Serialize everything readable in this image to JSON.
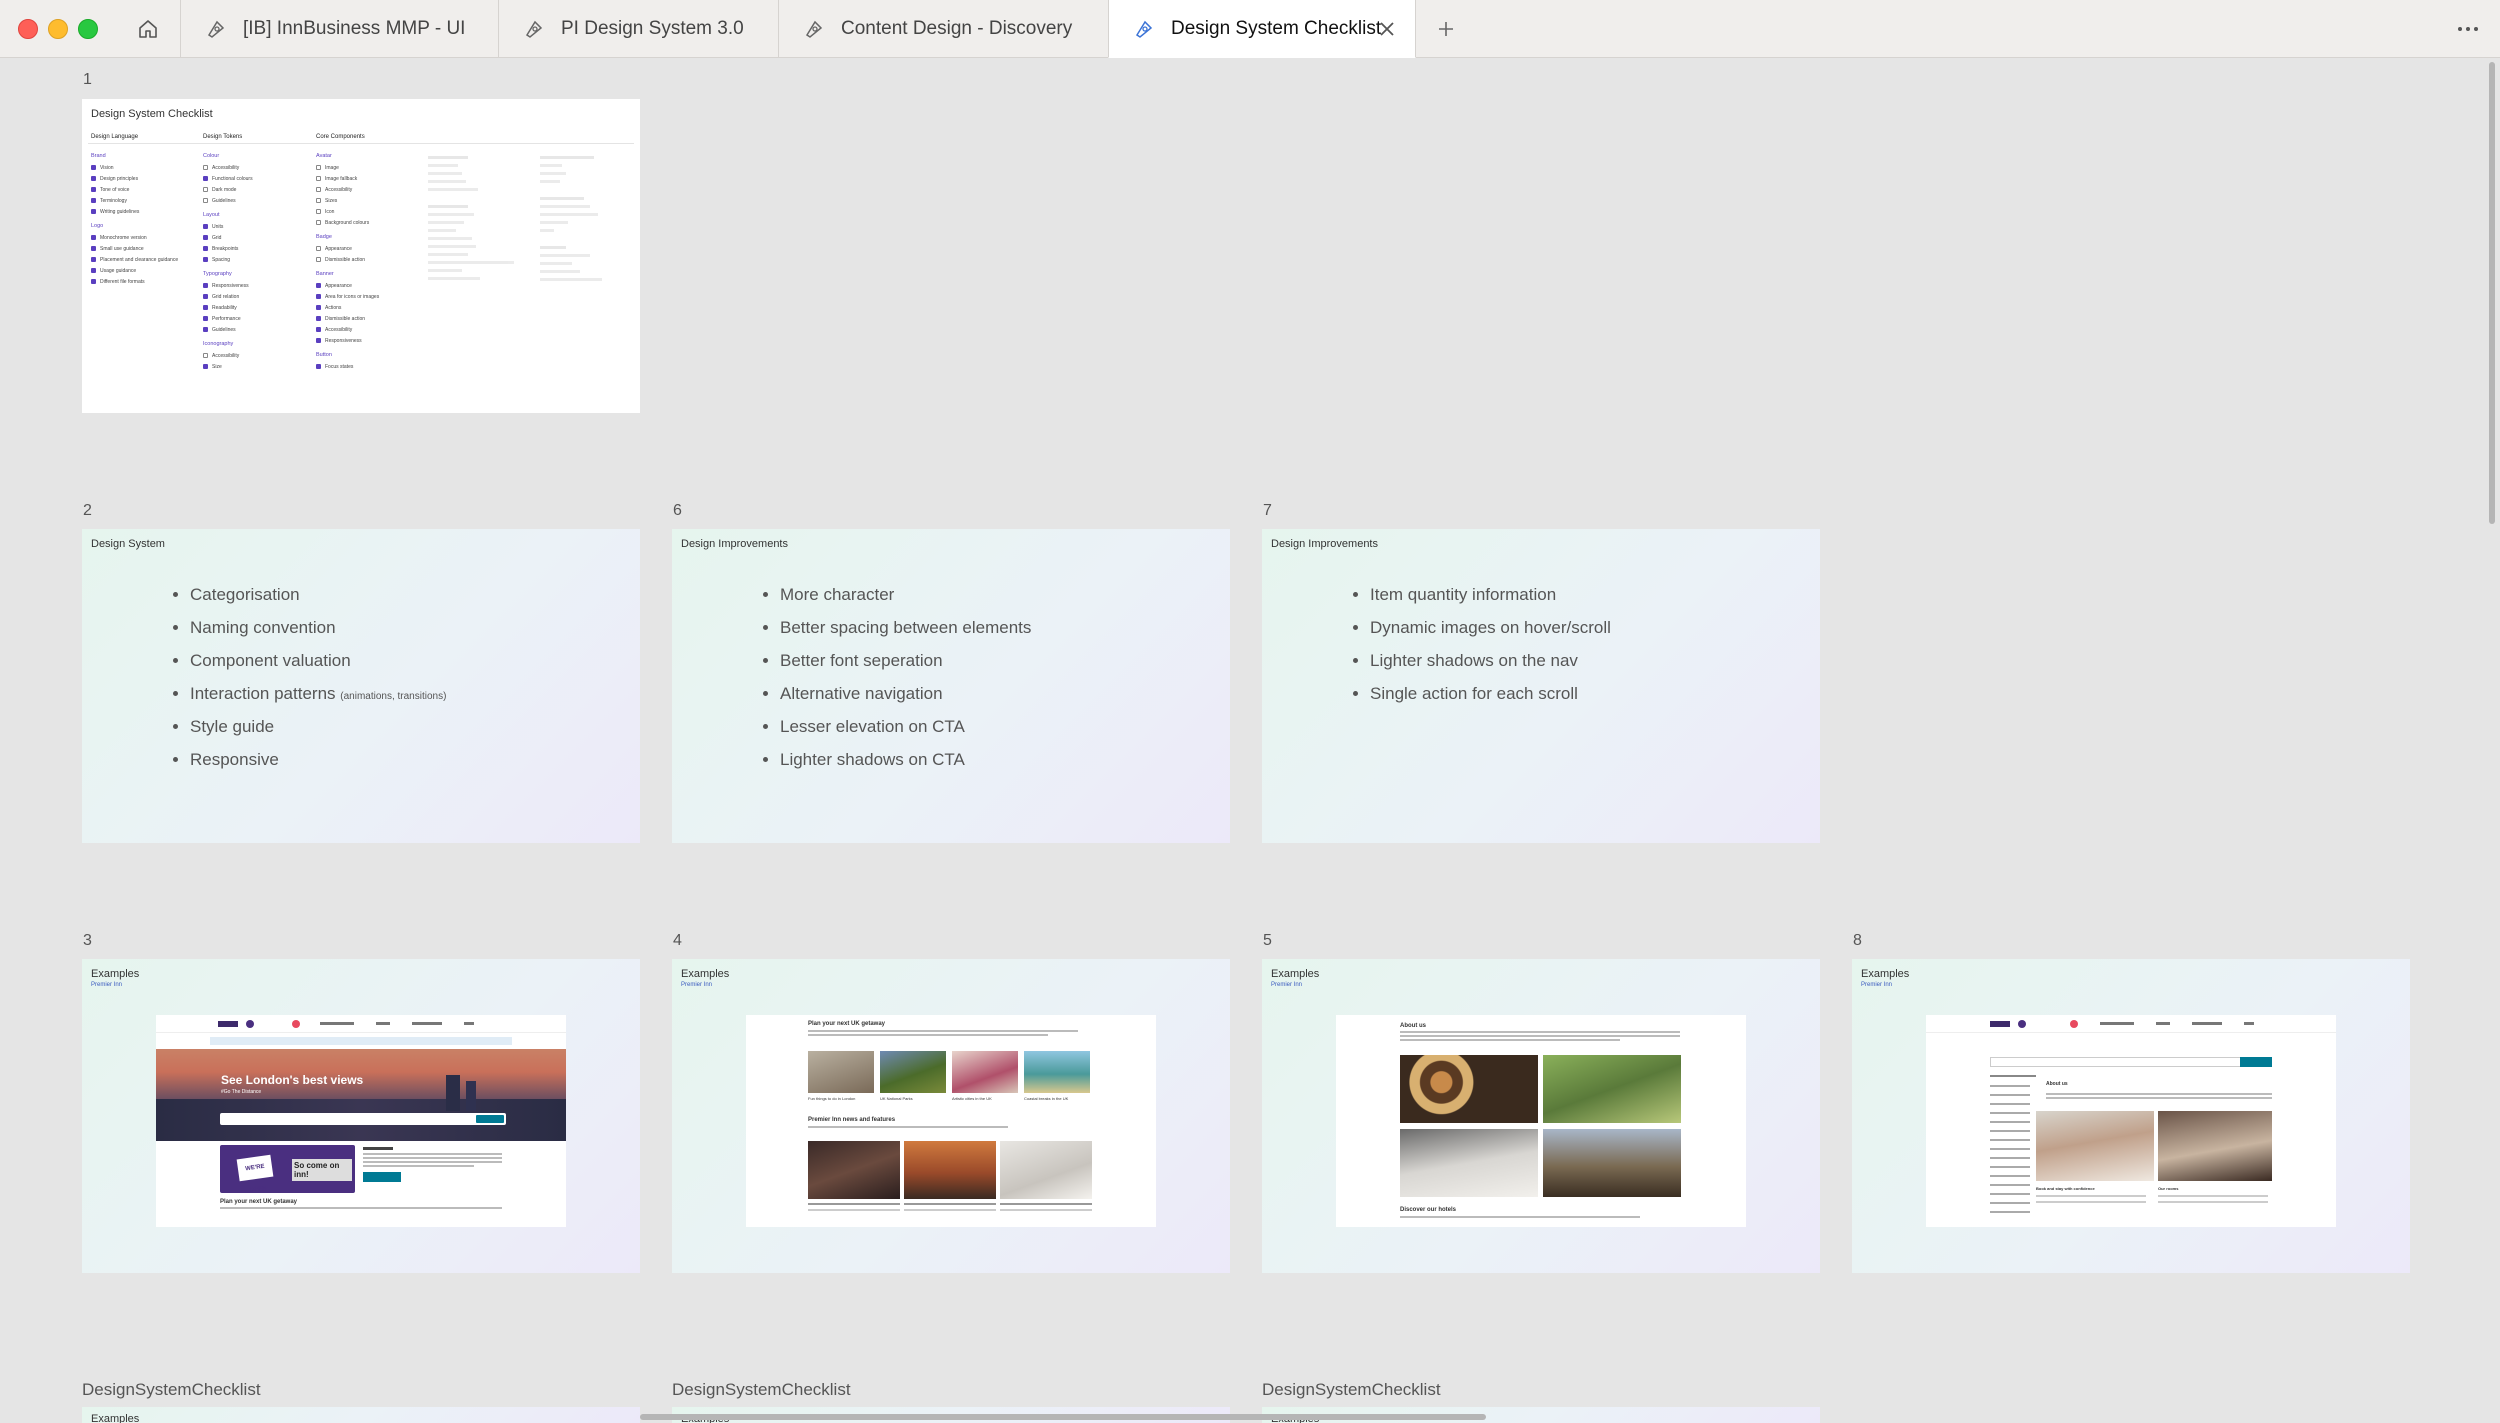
{
  "window": {
    "tabs": [
      {
        "label": "[IB] InnBusiness MMP - UI"
      },
      {
        "label": "PI Design System 3.0"
      },
      {
        "label": "Content Design - Discovery"
      },
      {
        "label": "Design System Checklist"
      }
    ]
  },
  "frames": {
    "f1": {
      "number": "1",
      "title": "Design System Checklist"
    },
    "f2": {
      "number": "2",
      "title": "Design System",
      "items": [
        "Categorisation",
        "Naming convention",
        "Component valuation",
        "Interaction patterns",
        "Style guide",
        "Responsive"
      ],
      "item4_note": "(animations, transitions)"
    },
    "f6": {
      "number": "6",
      "title": "Design Improvements",
      "items": [
        "More character",
        "Better spacing between elements",
        "Better font seperation",
        "Alternative navigation",
        "Lesser elevation on CTA",
        "Lighter shadows on CTA"
      ]
    },
    "f7": {
      "number": "7",
      "title": "Design Improvements",
      "items": [
        "Item quantity information",
        "Dynamic images on hover/scroll",
        "Lighter shadows on the nav",
        "Single action for each scroll"
      ]
    },
    "f3": {
      "number": "3",
      "title": "Examples",
      "sub": "Premier Inn",
      "hero": "See London's best views",
      "heroSub": "#Go The Distance",
      "promo": "So come on inn!",
      "badge": "WE'RE OPEN",
      "plan": "Plan your next UK getaway"
    },
    "f4": {
      "number": "4",
      "title": "Examples",
      "sub": "Premier Inn",
      "plan": "Plan your next UK getaway",
      "news": "Premier Inn news and features",
      "captions": [
        "Fun things to do in London",
        "UK National Parks",
        "Artistic cities in the UK",
        "Coastal breaks in the UK"
      ]
    },
    "f5": {
      "number": "5",
      "title": "Examples",
      "sub": "Premier Inn",
      "about": "About us",
      "discover": "Discover our hotels"
    },
    "f8": {
      "number": "8",
      "title": "Examples",
      "sub": "Premier Inn",
      "about": "About us",
      "cap1": "Book and stay with confidence",
      "cap2": "Our rooms"
    }
  },
  "checklist": {
    "columns": [
      {
        "title": "Design Language",
        "sections": [
          {
            "name": "Brand",
            "items": [
              [
                "Vision",
                1
              ],
              [
                "Design principles",
                1
              ],
              [
                "Tone of voice",
                1
              ],
              [
                "Terminology",
                1
              ],
              [
                "Writing guidelines",
                1
              ]
            ]
          },
          {
            "name": "Logo",
            "items": [
              [
                "Monochrome version",
                1
              ],
              [
                "Small use guidance",
                1
              ],
              [
                "Placement and clearance guidance",
                1
              ],
              [
                "Usage guidance",
                1
              ],
              [
                "Different file formats",
                1
              ]
            ]
          }
        ]
      },
      {
        "title": "Design Tokens",
        "sections": [
          {
            "name": "Colour",
            "items": [
              [
                "Accessibility",
                0
              ],
              [
                "Functional colours",
                1
              ],
              [
                "Dark mode",
                0
              ],
              [
                "Guidelines",
                0
              ]
            ]
          },
          {
            "name": "Layout",
            "items": [
              [
                "Units",
                1
              ],
              [
                "Grid",
                1
              ],
              [
                "Breakpoints",
                1
              ],
              [
                "Spacing",
                1
              ]
            ]
          },
          {
            "name": "Typography",
            "items": [
              [
                "Responsiveness",
                1
              ],
              [
                "Grid relation",
                1
              ],
              [
                "Readability",
                1
              ],
              [
                "Performance",
                1
              ],
              [
                "Guidelines",
                1
              ]
            ]
          },
          {
            "name": "Iconography",
            "items": [
              [
                "Accessibility",
                0
              ],
              [
                "Size",
                1
              ]
            ]
          }
        ]
      },
      {
        "title": "Core Components",
        "sections": [
          {
            "name": "Avatar",
            "items": [
              [
                "Image",
                0
              ],
              [
                "Image fallback",
                0
              ],
              [
                "Accessibility",
                0
              ],
              [
                "Sizes",
                0
              ],
              [
                "Icon",
                0
              ],
              [
                "Background colours",
                0
              ]
            ]
          },
          {
            "name": "Badge",
            "items": [
              [
                "Appearance",
                0
              ],
              [
                "Dismissible action",
                0
              ]
            ]
          },
          {
            "name": "Banner",
            "items": [
              [
                "Appearance",
                1
              ],
              [
                "Area for icons or images",
                1
              ],
              [
                "Actions",
                1
              ],
              [
                "Dismissible action",
                1
              ],
              [
                "Accessibility",
                1
              ],
              [
                "Responsiveness",
                1
              ]
            ]
          },
          {
            "name": "Button",
            "items": [
              [
                "Focus states",
                1
              ]
            ]
          }
        ]
      }
    ]
  }
}
